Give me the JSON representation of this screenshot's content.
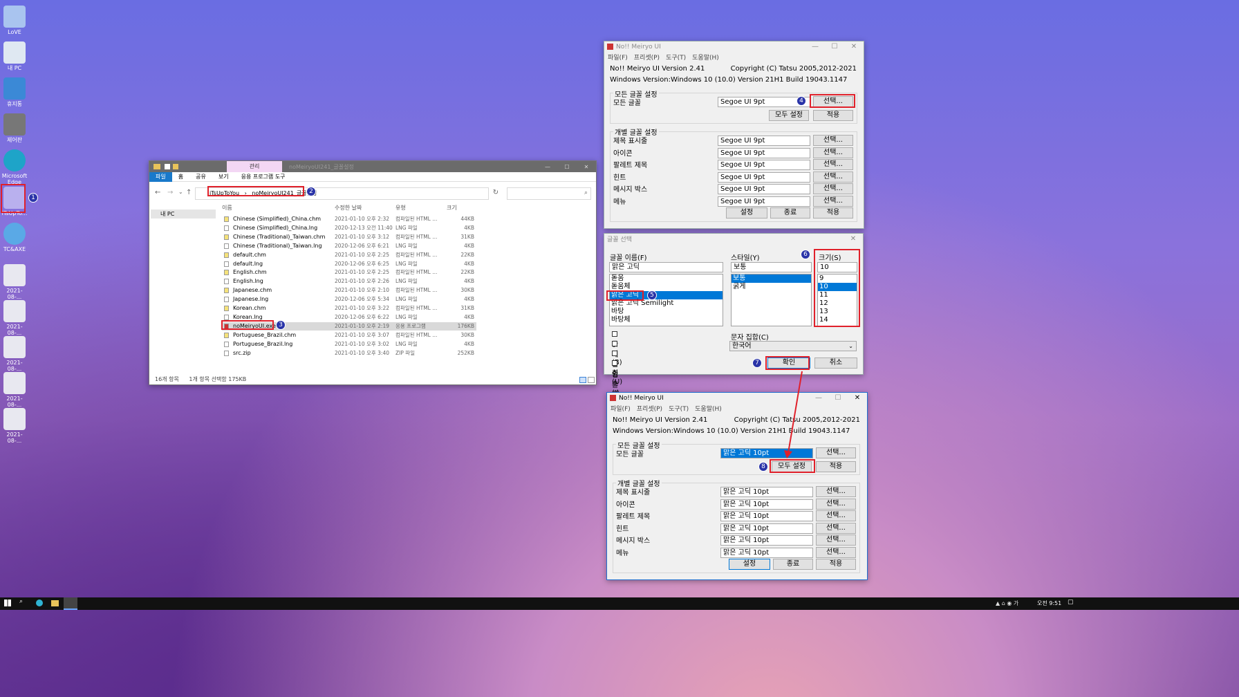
{
  "desktop": {
    "icons": [
      {
        "label": "LoVE",
        "name": "user-icon",
        "color": "#a9c4ef"
      },
      {
        "label": "내 PC",
        "name": "pc-icon",
        "color": "#dfe8f2"
      },
      {
        "label": "휴지통",
        "name": "recycle-bin-icon",
        "color": "#3b89d6"
      },
      {
        "label": "제어판",
        "name": "control-panel-icon",
        "color": "#777"
      },
      {
        "label": "Microsoft Edge",
        "name": "edge-icon",
        "color": "#1ea4c8"
      },
      {
        "label": "iTsUpTo...",
        "name": "folder-icon",
        "color": "#b9b0ee"
      },
      {
        "label": "TC&AXE",
        "name": "cloud-icon",
        "color": "#5aa9e6"
      },
      {
        "label": "2021-08-...",
        "name": "screenshot-file-icon",
        "color": "#e8e8f0"
      },
      {
        "label": "2021-08-...",
        "name": "screenshot-file-icon",
        "color": "#e8e8f0"
      },
      {
        "label": "2021-08-...",
        "name": "screenshot-file-icon",
        "color": "#e8e8f0"
      },
      {
        "label": "2021-08-...",
        "name": "screenshot-file-icon",
        "color": "#e8e8f0"
      },
      {
        "label": "2021-08-...",
        "name": "screenshot-file-icon",
        "color": "#e8e8f0"
      }
    ]
  },
  "badges": [
    "1",
    "2",
    "3",
    "4",
    "5",
    "6",
    "7",
    "8"
  ],
  "explorer": {
    "context_tab": "관리",
    "title": "noMeiryoUI241_글꼴설정",
    "ribbon_tabs": [
      "파일",
      "홈",
      "공유",
      "보기",
      "응용 프로그램 도구"
    ],
    "path": [
      "iTsUpToYou",
      "noMeiryoUI241_글꼴설정"
    ],
    "nav_pc": "내 PC",
    "columns": [
      "이름",
      "수정한 날짜",
      "유형",
      "크기"
    ],
    "files": [
      {
        "name": "Chinese (Simplified)_China.chm",
        "date": "2021-01-10 오후 2:32",
        "type": "컴파일된 HTML ...",
        "size": "44KB"
      },
      {
        "name": "Chinese (Simplified)_China.lng",
        "date": "2020-12-13 오전 11:40",
        "type": "LNG 파일",
        "size": "4KB"
      },
      {
        "name": "Chinese (Traditional)_Taiwan.chm",
        "date": "2021-01-10 오후 3:12",
        "type": "컴파일된 HTML ...",
        "size": "31KB"
      },
      {
        "name": "Chinese (Traditional)_Taiwan.lng",
        "date": "2020-12-06 오후 6:21",
        "type": "LNG 파일",
        "size": "4KB"
      },
      {
        "name": "default.chm",
        "date": "2021-01-10 오후 2:25",
        "type": "컴파일된 HTML ...",
        "size": "22KB"
      },
      {
        "name": "default.lng",
        "date": "2020-12-06 오후 6:25",
        "type": "LNG 파일",
        "size": "4KB"
      },
      {
        "name": "English.chm",
        "date": "2021-01-10 오후 2:25",
        "type": "컴파일된 HTML ...",
        "size": "22KB"
      },
      {
        "name": "English.lng",
        "date": "2021-01-10 오후 2:26",
        "type": "LNG 파일",
        "size": "4KB"
      },
      {
        "name": "Japanese.chm",
        "date": "2021-01-10 오후 2:10",
        "type": "컴파일된 HTML ...",
        "size": "30KB"
      },
      {
        "name": "Japanese.lng",
        "date": "2020-12-06 오후 5:34",
        "type": "LNG 파일",
        "size": "4KB"
      },
      {
        "name": "Korean.chm",
        "date": "2021-01-10 오후 3:22",
        "type": "컴파일된 HTML ...",
        "size": "31KB"
      },
      {
        "name": "Korean.lng",
        "date": "2020-12-06 오후 6:22",
        "type": "LNG 파일",
        "size": "4KB"
      },
      {
        "name": "noMeiryoUI.exe",
        "date": "2021-01-10 오후 2:19",
        "type": "응용 프로그램",
        "size": "176KB"
      },
      {
        "name": "Portuguese_Brazil.chm",
        "date": "2021-01-10 오후 3:07",
        "type": "컴파일된 HTML ...",
        "size": "30KB"
      },
      {
        "name": "Portuguese_Brazil.lng",
        "date": "2021-01-10 오후 3:02",
        "type": "LNG 파일",
        "size": "4KB"
      },
      {
        "name": "src.zip",
        "date": "2021-01-10 오후 3:40",
        "type": "ZIP 파일",
        "size": "252KB"
      }
    ],
    "status_count": "16개 항목",
    "status_sel": "1개 항목 선택함 175KB"
  },
  "meiryo": {
    "title": "No!! Meiryo UI",
    "menu": [
      "파일(F)",
      "프리셋(P)",
      "도구(T)",
      "도움말(H)"
    ],
    "version": "No!! Meiryo UI Version 2.41",
    "copyright": "Copyright (C) Tatsu 2005,2012-2021",
    "winver": "Windows Version:Windows 10 (10.0) Version 21H1 Build 19043.1147",
    "all_group": "모든 글꼴 설정",
    "all_label": "모든 글꼴",
    "indiv_group": "개별 글꼴 설정",
    "items": [
      "제목 표시줄",
      "아이콘",
      "팔레트 제목",
      "힌트",
      "메시지 박스",
      "메뉴"
    ],
    "select_btn": "선택...",
    "set_all_btn": "모두 설정",
    "apply_btn": "적용",
    "set_btn": "설정",
    "exit_btn": "종료",
    "font_before": "Segoe UI  9pt",
    "font_after": "맑은 고딕  10pt"
  },
  "fontdlg": {
    "title": "글꼴 선택",
    "name_label": "글꼴 이름(F)",
    "name_value": "맑은 고딕",
    "fonts": [
      "돋움",
      "돋움체",
      "맑은 고딕",
      "맑은 고딕 Semilight",
      "바탕",
      "바탕체"
    ],
    "style_label": "스타일(Y)",
    "style_value": "보통",
    "styles": [
      "보통",
      "굵게"
    ],
    "size_label": "크기(S)",
    "size_value": "10",
    "sizes": [
      "9",
      "10",
      "11",
      "12",
      "13",
      "14"
    ],
    "effects": [
      "굵게(B)",
      "기울임꼴(I)",
      "밑줄(U)",
      "취소선(T)"
    ],
    "charset_label": "문자 집합(C)",
    "charset_value": "한국어",
    "ok": "확인",
    "cancel": "취소"
  },
  "taskbar": {
    "time": "오전 9:51"
  }
}
